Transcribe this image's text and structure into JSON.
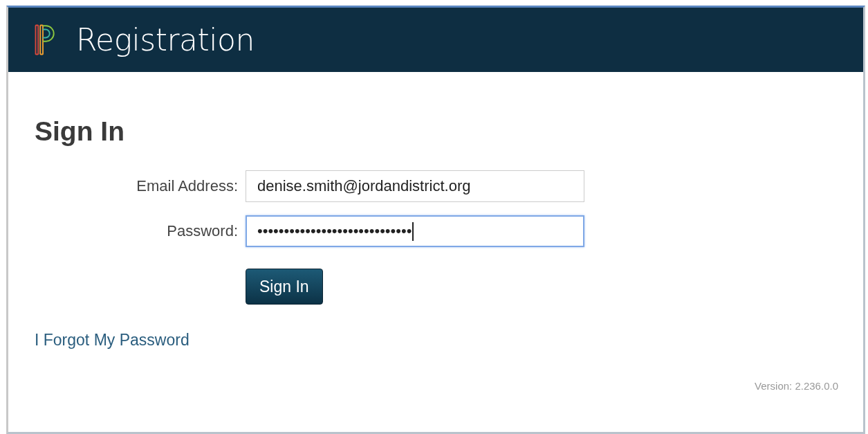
{
  "header": {
    "title": "Registration"
  },
  "heading": "Sign In",
  "fields": [
    {
      "label": "Email Address:",
      "value": "denise.smith@jordandistrict.org",
      "focused": false
    },
    {
      "label": "Password:",
      "value": "•••••••••••••••••••••••••••••",
      "focused": true
    }
  ],
  "submit": "Sign In",
  "forgot_link": "I Forgot My Password",
  "version": "Version: 2.236.0.0"
}
